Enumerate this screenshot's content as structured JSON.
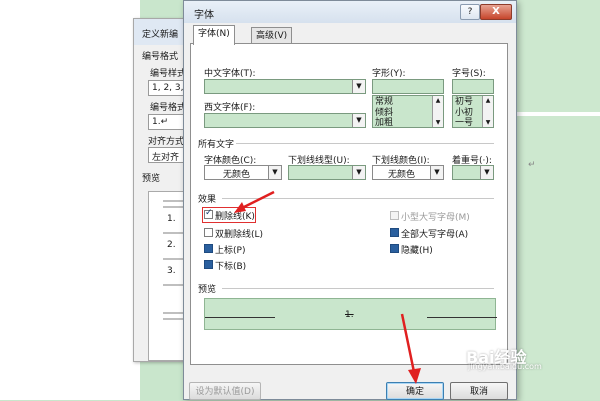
{
  "back_dialog": {
    "title": "定义新编",
    "numbering_style_group": "编号格式",
    "numbering_style_label": "编号样式",
    "numbering_style_value": "1, 2, 3,",
    "numbering_format_label": "编号格式",
    "numbering_format_value": "1.↵",
    "alignment_label": "对齐方式",
    "alignment_value": "左对齐",
    "preview_label": "预览",
    "preview_items": [
      "1.",
      "2.",
      "3."
    ]
  },
  "dialog": {
    "title": "字体",
    "help_label": "?",
    "close_label": "X",
    "tabs": [
      {
        "label": "字体(N)",
        "active": true
      },
      {
        "label": "高级(V)",
        "active": false
      }
    ],
    "chinese_font_label": "中文字体(T):",
    "chinese_font_value": "",
    "western_font_label": "西文字体(F):",
    "western_font_value": "",
    "font_style_label": "字形(Y):",
    "font_style_options": [
      "常规",
      "倾斜",
      "加粗"
    ],
    "font_size_label": "字号(S):",
    "font_size_options": [
      "初号",
      "小初",
      "一号"
    ],
    "all_text_group": "所有文字",
    "font_color_label": "字体颜色(C):",
    "font_color_value": "无颜色",
    "underline_style_label": "下划线线型(U):",
    "underline_style_value": "",
    "underline_color_label": "下划线颜色(I):",
    "underline_color_value": "无颜色",
    "emphasis_label": "着重号(·):",
    "emphasis_value": "",
    "effects_group": "效果",
    "effects": {
      "strikethrough": {
        "label": "删除线(K)",
        "state": "checked"
      },
      "double_strikethrough": {
        "label": "双删除线(L)",
        "state": "unchecked"
      },
      "superscript": {
        "label": "上标(P)",
        "state": "indeterminate"
      },
      "subscript": {
        "label": "下标(B)",
        "state": "indeterminate"
      },
      "small_caps": {
        "label": "小型大写字母(M)",
        "state": "disabled"
      },
      "all_caps": {
        "label": "全部大写字母(A)",
        "state": "indeterminate"
      },
      "hidden": {
        "label": "隐藏(H)",
        "state": "indeterminate"
      }
    },
    "preview_group": "预览",
    "preview_text": "1.",
    "default_button": "设为默认值(D)",
    "ok_button": "确定",
    "cancel_button": "取消"
  },
  "document": {
    "paragraph_mark": "↵"
  },
  "watermark": {
    "brand": "Bai经验",
    "url": "jingyan.baidu.com"
  },
  "colors": {
    "accent_green": "#c9e6cc",
    "annotation_red": "#e02020",
    "checkbox_blue": "#2a5f9e"
  }
}
